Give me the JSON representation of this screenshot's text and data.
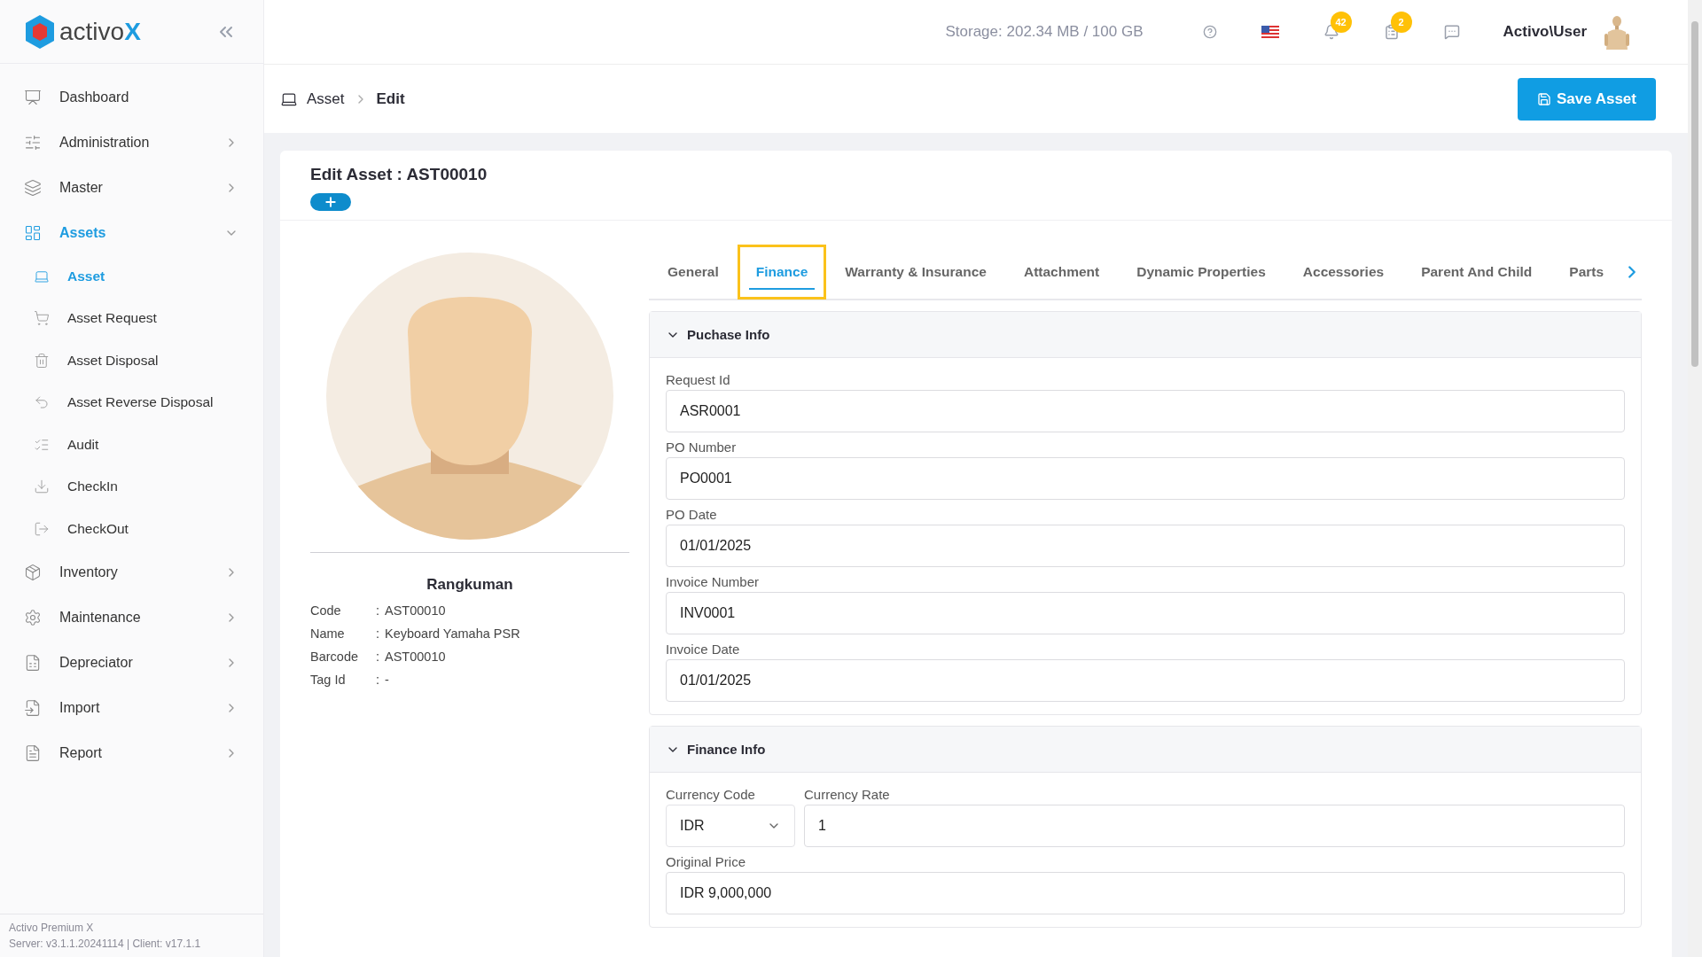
{
  "brand": {
    "name": "activo",
    "mark": "X"
  },
  "sidebar": {
    "items": [
      {
        "label": "Dashboard",
        "kind": "link",
        "selected": false
      },
      {
        "label": "Administration",
        "kind": "group",
        "selected": false,
        "expanded": false
      },
      {
        "label": "Master",
        "kind": "group",
        "selected": false,
        "expanded": false
      },
      {
        "label": "Assets",
        "kind": "group",
        "selected": true,
        "expanded": true,
        "children": [
          {
            "label": "Asset",
            "selected": true
          },
          {
            "label": "Asset Request",
            "selected": false
          },
          {
            "label": "Asset Disposal",
            "selected": false
          },
          {
            "label": "Asset Reverse Disposal",
            "selected": false
          },
          {
            "label": "Audit",
            "selected": false
          },
          {
            "label": "CheckIn",
            "selected": false
          },
          {
            "label": "CheckOut",
            "selected": false
          }
        ]
      },
      {
        "label": "Inventory",
        "kind": "group",
        "selected": false,
        "expanded": false
      },
      {
        "label": "Maintenance",
        "kind": "group",
        "selected": false,
        "expanded": false
      },
      {
        "label": "Depreciator",
        "kind": "group",
        "selected": false,
        "expanded": false
      },
      {
        "label": "Import",
        "kind": "group",
        "selected": false,
        "expanded": false
      },
      {
        "label": "Report",
        "kind": "group",
        "selected": false,
        "expanded": false
      }
    ],
    "footer": [
      "Activo Premium X",
      "Server: v3.1.1.20241114 | Client: v17.1.1"
    ]
  },
  "topbar": {
    "storage": "Storage: 202.34 MB / 100 GB",
    "notifications": "42",
    "tasks": "2",
    "user": "Activo\\User"
  },
  "breadcrumb": [
    "Asset",
    "Edit"
  ],
  "save_button": "Save Asset",
  "card": {
    "title": "Edit Asset : AST00010"
  },
  "summary": {
    "title": "Rangkuman",
    "separator": ":",
    "rows": [
      {
        "label": "Code",
        "value": "AST00010"
      },
      {
        "label": "Name",
        "value": "Keyboard Yamaha PSR"
      },
      {
        "label": "Barcode",
        "value": "AST00010"
      },
      {
        "label": "Tag Id",
        "value": "-"
      }
    ]
  },
  "tabs": [
    {
      "label": "General",
      "selected": false,
      "highlighted": false
    },
    {
      "label": "Finance",
      "selected": true,
      "highlighted": true
    },
    {
      "label": "Warranty & Insurance",
      "selected": false,
      "highlighted": false
    },
    {
      "label": "Attachment",
      "selected": false,
      "highlighted": false
    },
    {
      "label": "Dynamic Properties",
      "selected": false,
      "highlighted": false
    },
    {
      "label": "Accessories",
      "selected": false,
      "highlighted": false
    },
    {
      "label": "Parent And Child",
      "selected": false,
      "highlighted": false
    },
    {
      "label": "Parts",
      "selected": false,
      "highlighted": false
    }
  ],
  "sections": [
    {
      "title": "Puchase Info",
      "expanded": true,
      "rows": [
        [
          {
            "label": "Request Id",
            "value": "ASR0001",
            "kind": "input"
          }
        ],
        [
          {
            "label": "PO Number",
            "value": "PO0001",
            "kind": "input"
          }
        ],
        [
          {
            "label": "PO Date",
            "value": "01/01/2025",
            "kind": "input"
          }
        ],
        [
          {
            "label": "Invoice Number",
            "value": "INV0001",
            "kind": "input"
          }
        ],
        [
          {
            "label": "Invoice Date",
            "value": "01/01/2025",
            "kind": "input"
          }
        ]
      ]
    },
    {
      "title": "Finance Info",
      "expanded": true,
      "rows": [
        [
          {
            "label": "Currency Code",
            "value": "IDR",
            "kind": "select"
          },
          {
            "label": "Currency Rate",
            "value": "1",
            "kind": "input"
          }
        ],
        [
          {
            "label": "Original Price",
            "value": "IDR 9,000,000",
            "kind": "input"
          }
        ]
      ]
    }
  ]
}
